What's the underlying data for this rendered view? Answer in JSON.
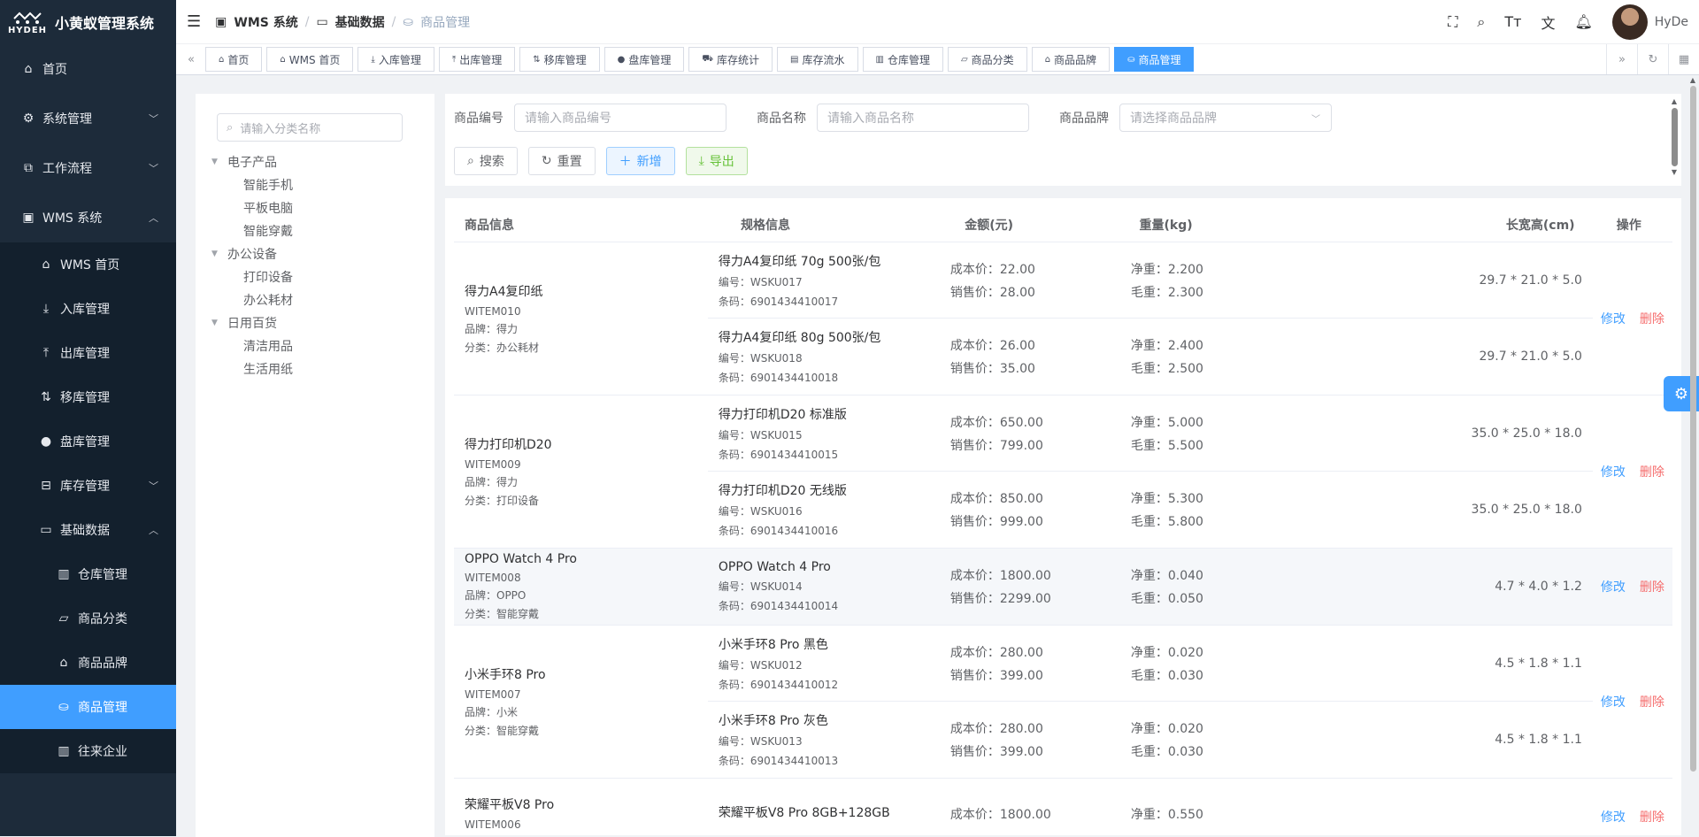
{
  "app": {
    "logo_text": "HYDEH",
    "title": "小黄蚁管理系统"
  },
  "sidebar": {
    "items": [
      {
        "label": "首页",
        "icon": "home-icon"
      },
      {
        "label": "系统管理",
        "icon": "gear-icon"
      },
      {
        "label": "工作流程",
        "icon": "workflow-icon"
      },
      {
        "label": "WMS 系统",
        "icon": "box-icon"
      }
    ],
    "wms_children": [
      {
        "label": "WMS 首页"
      },
      {
        "label": "入库管理"
      },
      {
        "label": "出库管理"
      },
      {
        "label": "移库管理"
      },
      {
        "label": "盘库管理"
      },
      {
        "label": "库存管理"
      },
      {
        "label": "基础数据"
      }
    ],
    "base_children": [
      {
        "label": "仓库管理"
      },
      {
        "label": "商品分类"
      },
      {
        "label": "商品品牌"
      },
      {
        "label": "商品管理"
      },
      {
        "label": "往来企业"
      }
    ]
  },
  "breadcrumb": {
    "b1": "WMS 系统",
    "b2": "基础数据",
    "b3": "商品管理",
    "sep": "/"
  },
  "user": {
    "name": "HyDe"
  },
  "tags": [
    "首页",
    "WMS 首页",
    "入库管理",
    "出库管理",
    "移库管理",
    "盘库管理",
    "库存统计",
    "库存流水",
    "仓库管理",
    "商品分类",
    "商品品牌",
    "商品管理"
  ],
  "tree": {
    "search_placeholder": "请输入分类名称",
    "groups": [
      {
        "label": "电子产品",
        "children": [
          "智能手机",
          "平板电脑",
          "智能穿戴"
        ]
      },
      {
        "label": "办公设备",
        "children": [
          "打印设备",
          "办公耗材"
        ]
      },
      {
        "label": "日用百货",
        "children": [
          "清洁用品",
          "生活用纸"
        ]
      }
    ]
  },
  "search": {
    "code_label": "商品编号",
    "code_placeholder": "请输入商品编号",
    "name_label": "商品名称",
    "name_placeholder": "请输入商品名称",
    "brand_label": "商品品牌",
    "brand_placeholder": "请选择商品品牌",
    "search_btn": "搜索",
    "reset_btn": "重置",
    "add_btn": "新增",
    "export_btn": "导出"
  },
  "table": {
    "headers": [
      "商品信息",
      "规格信息",
      "金额(元)",
      "重量(kg)",
      "长宽高(cm)",
      "操作"
    ],
    "edit_label": "修改",
    "delete_label": "删除",
    "products": [
      {
        "name": "得力A4复印纸",
        "code": "WITEM010",
        "brand": "品牌：得力",
        "category": "分类：办公耗材",
        "skus": [
          {
            "name": "得力A4复印纸 70g 500张/包",
            "sku": "编号：WSKU017",
            "barcode": "条码：6901434410017",
            "cost": "成本价：22.00",
            "price": "销售价：28.00",
            "net": "净重：2.200",
            "gross": "毛重：2.300",
            "dims": "29.7 * 21.0 * 5.0"
          },
          {
            "name": "得力A4复印纸 80g 500张/包",
            "sku": "编号：WSKU018",
            "barcode": "条码：6901434410018",
            "cost": "成本价：26.00",
            "price": "销售价：35.00",
            "net": "净重：2.400",
            "gross": "毛重：2.500",
            "dims": "29.7 * 21.0 * 5.0"
          }
        ]
      },
      {
        "name": "得力打印机D20",
        "code": "WITEM009",
        "brand": "品牌：得力",
        "category": "分类：打印设备",
        "skus": [
          {
            "name": "得力打印机D20 标准版",
            "sku": "编号：WSKU015",
            "barcode": "条码：6901434410015",
            "cost": "成本价：650.00",
            "price": "销售价：799.00",
            "net": "净重：5.000",
            "gross": "毛重：5.500",
            "dims": "35.0 * 25.0 * 18.0"
          },
          {
            "name": "得力打印机D20 无线版",
            "sku": "编号：WSKU016",
            "barcode": "条码：6901434410016",
            "cost": "成本价：850.00",
            "price": "销售价：999.00",
            "net": "净重：5.300",
            "gross": "毛重：5.800",
            "dims": "35.0 * 25.0 * 18.0"
          }
        ]
      },
      {
        "name": "OPPO Watch 4 Pro",
        "code": "WITEM008",
        "brand": "品牌：OPPO",
        "category": "分类：智能穿戴",
        "skus": [
          {
            "name": "OPPO Watch 4 Pro",
            "sku": "编号：WSKU014",
            "barcode": "条码：6901434410014",
            "cost": "成本价：1800.00",
            "price": "销售价：2299.00",
            "net": "净重：0.040",
            "gross": "毛重：0.050",
            "dims": "4.7 * 4.0 * 1.2"
          }
        ]
      },
      {
        "name": "小米手环8 Pro",
        "code": "WITEM007",
        "brand": "品牌：小米",
        "category": "分类：智能穿戴",
        "skus": [
          {
            "name": "小米手环8 Pro 黑色",
            "sku": "编号：WSKU012",
            "barcode": "条码：6901434410012",
            "cost": "成本价：280.00",
            "price": "销售价：399.00",
            "net": "净重：0.020",
            "gross": "毛重：0.030",
            "dims": "4.5 * 1.8 * 1.1"
          },
          {
            "name": "小米手环8 Pro 灰色",
            "sku": "编号：WSKU013",
            "barcode": "条码：6901434410013",
            "cost": "成本价：280.00",
            "price": "销售价：399.00",
            "net": "净重：0.020",
            "gross": "毛重：0.030",
            "dims": "4.5 * 1.8 * 1.1"
          }
        ]
      },
      {
        "name": "荣耀平板V8 Pro",
        "code": "WITEM006",
        "brand": "",
        "category": "",
        "skus": [
          {
            "name": "荣耀平板V8 Pro 8GB+128GB",
            "sku": "",
            "barcode": "",
            "cost": "成本价：1800.00",
            "price": "",
            "net": "净重：0.550",
            "gross": "",
            "dims": ""
          }
        ]
      }
    ]
  },
  "colors": {
    "sidebar_bg": "#1d2b3a",
    "accent": "#409eff",
    "danger": "#f56c6c",
    "success": "#67c23a"
  }
}
